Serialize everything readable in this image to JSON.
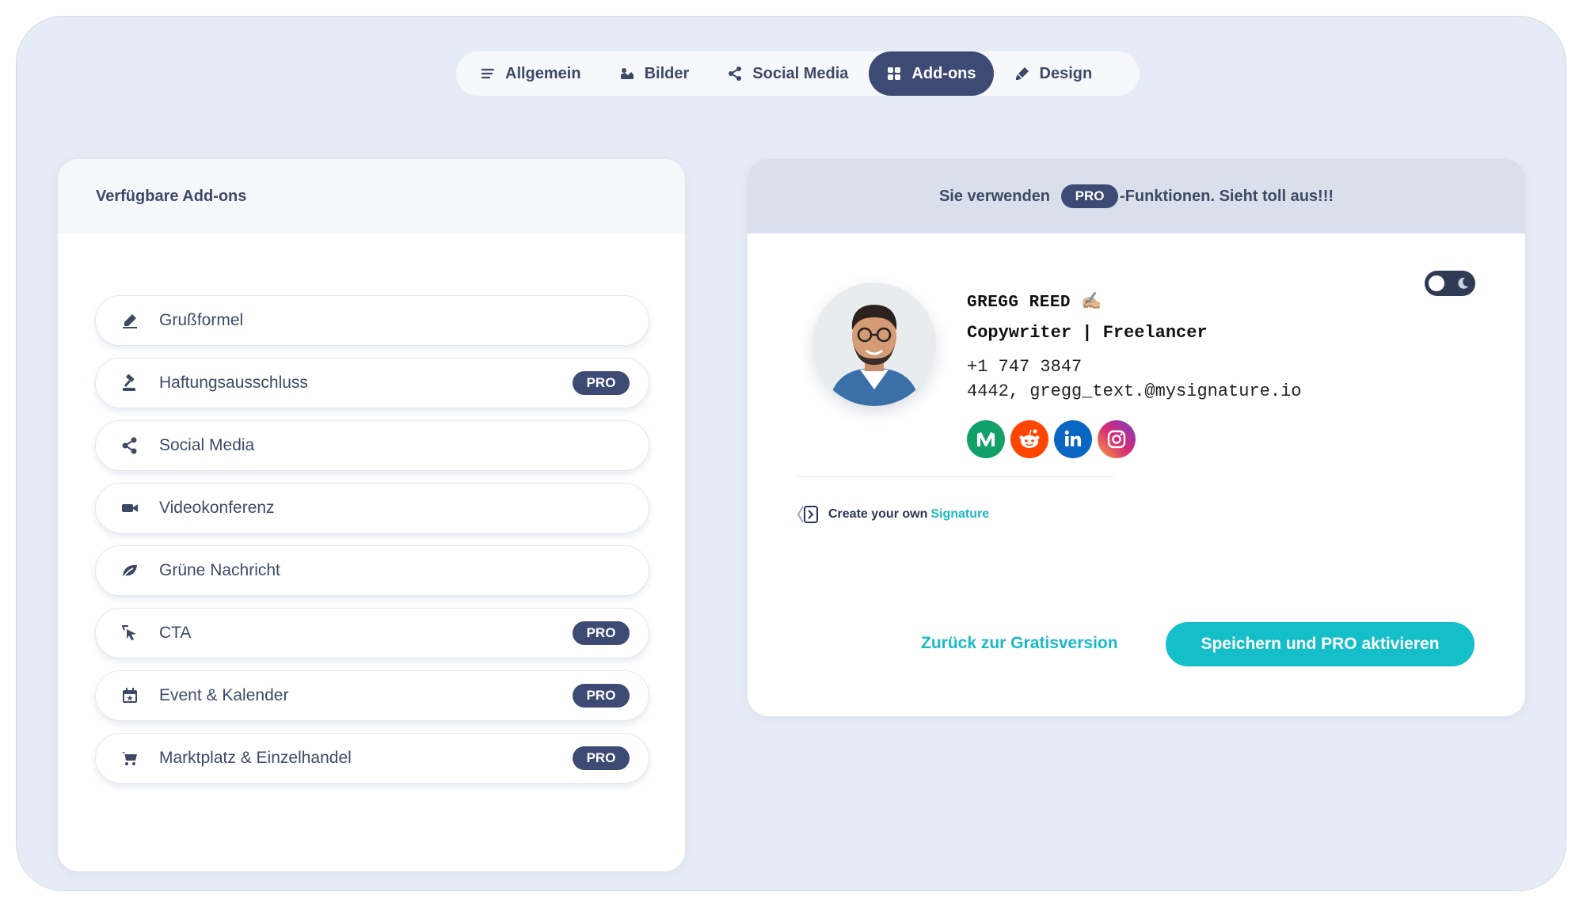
{
  "tabs": [
    {
      "label": "Allgemein",
      "icon": "lines-icon",
      "active": false
    },
    {
      "label": "Bilder",
      "icon": "images-icon",
      "active": false
    },
    {
      "label": "Social Media",
      "icon": "share-icon",
      "active": false
    },
    {
      "label": "Add-ons",
      "icon": "grid-icon",
      "active": true
    },
    {
      "label": "Design",
      "icon": "brush-icon",
      "active": false
    }
  ],
  "left_panel": {
    "title": "Verfügbare Add-ons",
    "items": [
      {
        "label": "Grußformel",
        "icon": "signature-pen-icon",
        "pro": false
      },
      {
        "label": "Haftungsausschluss",
        "icon": "gavel-icon",
        "pro": true,
        "badge": "PRO"
      },
      {
        "label": "Social Media",
        "icon": "share-icon",
        "pro": false
      },
      {
        "label": "Videokonferenz",
        "icon": "video-camera-icon",
        "pro": false
      },
      {
        "label": "Grüne Nachricht",
        "icon": "leaf-icon",
        "pro": false
      },
      {
        "label": "CTA",
        "icon": "cursor-click-icon",
        "pro": true,
        "badge": "PRO"
      },
      {
        "label": "Event & Kalender",
        "icon": "calendar-star-icon",
        "pro": true,
        "badge": "PRO"
      },
      {
        "label": "Marktplatz & Einzelhandel",
        "icon": "cart-icon",
        "pro": true,
        "badge": "PRO"
      }
    ]
  },
  "right_panel": {
    "banner_before": "Sie verwenden",
    "banner_badge": "PRO",
    "banner_after": "-Funktionen. Sieht toll aus!!!",
    "signature": {
      "name": "GREGG REED ✍🏼",
      "title": "Copywriter | Freelancer",
      "phone": "+1 747 3847",
      "email_line": "4442, gregg_text.@mysignature.io",
      "socials": [
        {
          "name": "medium-icon",
          "color": "#12a06a"
        },
        {
          "name": "reddit-icon",
          "color": "#ff4500"
        },
        {
          "name": "linkedin-icon",
          "color": "#0a66c2"
        },
        {
          "name": "instagram-icon",
          "color": "#c13584"
        }
      ]
    },
    "create_own_prefix": "Create your own",
    "create_own_accent": "Signature",
    "back_link": "Zurück zur Gratisversion",
    "save_button": "Speichern und PRO aktivieren"
  },
  "colors": {
    "accent": "#14bfc9",
    "navy": "#3d4a73",
    "background": "#e6ecf5"
  }
}
